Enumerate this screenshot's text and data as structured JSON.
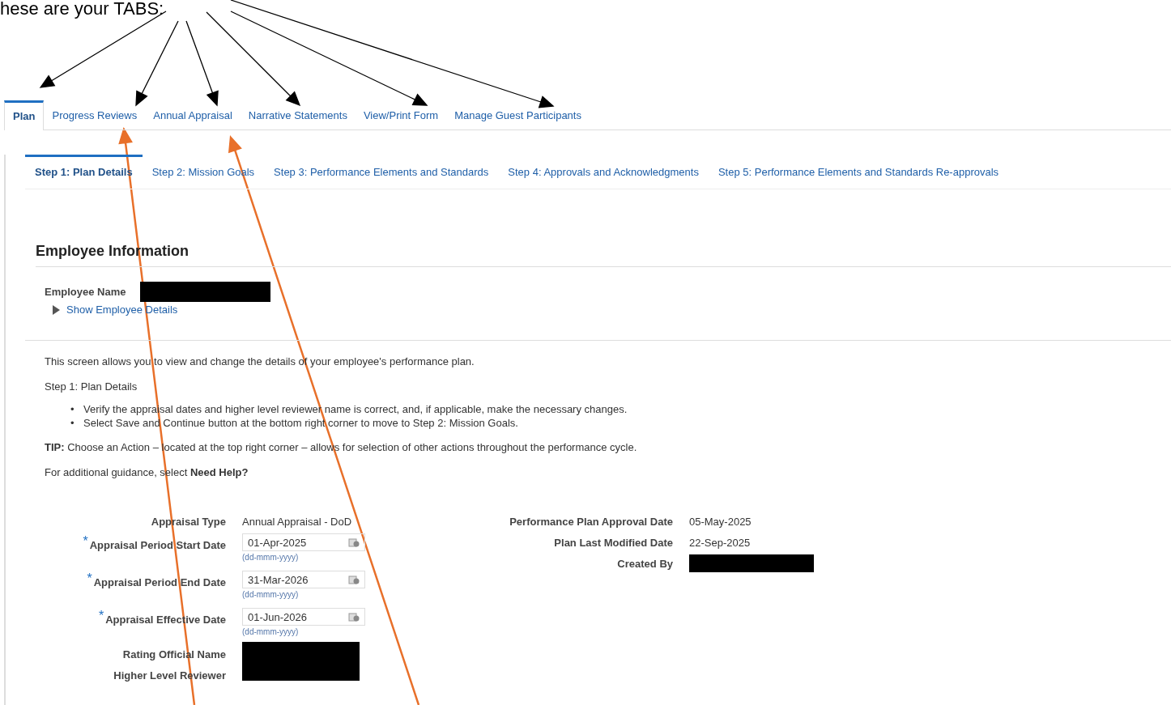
{
  "annotation": {
    "caption": "hese are your TABS:"
  },
  "tabs": [
    {
      "label": "Plan",
      "selected": true
    },
    {
      "label": "Progress Reviews",
      "selected": false
    },
    {
      "label": "Annual Appraisal",
      "selected": false
    },
    {
      "label": "Narrative Statements",
      "selected": false
    },
    {
      "label": "View/Print Form",
      "selected": false
    },
    {
      "label": "Manage Guest Participants",
      "selected": false
    }
  ],
  "step_tabs": [
    {
      "label": "Step 1: Plan Details",
      "selected": true
    },
    {
      "label": "Step 2: Mission Goals",
      "selected": false
    },
    {
      "label": "Step 3: Performance Elements and Standards",
      "selected": false
    },
    {
      "label": "Step 4: Approvals and Acknowledgments",
      "selected": false
    },
    {
      "label": "Step 5: Performance Elements and Standards Re-approvals",
      "selected": false
    }
  ],
  "section_title": "Employee Information",
  "employee": {
    "label": "Employee Name",
    "details_link": "Show Employee Details"
  },
  "instructions": {
    "intro": "This screen allows you to view and change the details of your employee's performance plan.",
    "step": "Step 1: Plan Details",
    "bullets": [
      {
        "marker": "•",
        "text": "Verify the appraisal dates and higher level reviewer name is correct, and, if applicable, make the necessary changes."
      },
      {
        "marker": "•",
        "text": "Select Save and Continue button at the bottom right corner to move to Step 2: Mission Goals."
      }
    ],
    "tip": "**TIP:** Choose an Action – located at the top right corner – allows for selection of other actions throughout the performance cycle.",
    "guidance": "For additional guidance, select  **Need Help?**"
  },
  "left_fields": [
    {
      "kind": "text",
      "label": "Appraisal Type",
      "value": "Annual Appraisal - DoD"
    },
    {
      "kind": "date",
      "label": "Appraisal Period Start Date",
      "value": "01-Apr-2025",
      "hint": "(dd-mmm-yyyy)",
      "required_mark": "*"
    },
    {
      "kind": "date",
      "label": "Appraisal Period End Date",
      "value": "31-Mar-2026",
      "hint": "(dd-mmm-yyyy)",
      "required_mark": "*"
    },
    {
      "kind": "date",
      "label": "Appraisal Effective Date",
      "value": "01-Jun-2026",
      "hint": "(dd-mmm-yyyy)",
      "required_mark": "*"
    },
    {
      "kind": "redacted",
      "label": "Rating Official Name"
    },
    {
      "kind": "redacted",
      "label": "Higher Level Reviewer"
    }
  ],
  "right_fields": [
    {
      "kind": "text",
      "label": "Performance Plan Approval Date",
      "value": "05-May-2025"
    },
    {
      "kind": "text",
      "label": "Plan Last Modified Date",
      "value": "22-Sep-2025"
    },
    {
      "kind": "redacted",
      "label": "Created By"
    }
  ]
}
